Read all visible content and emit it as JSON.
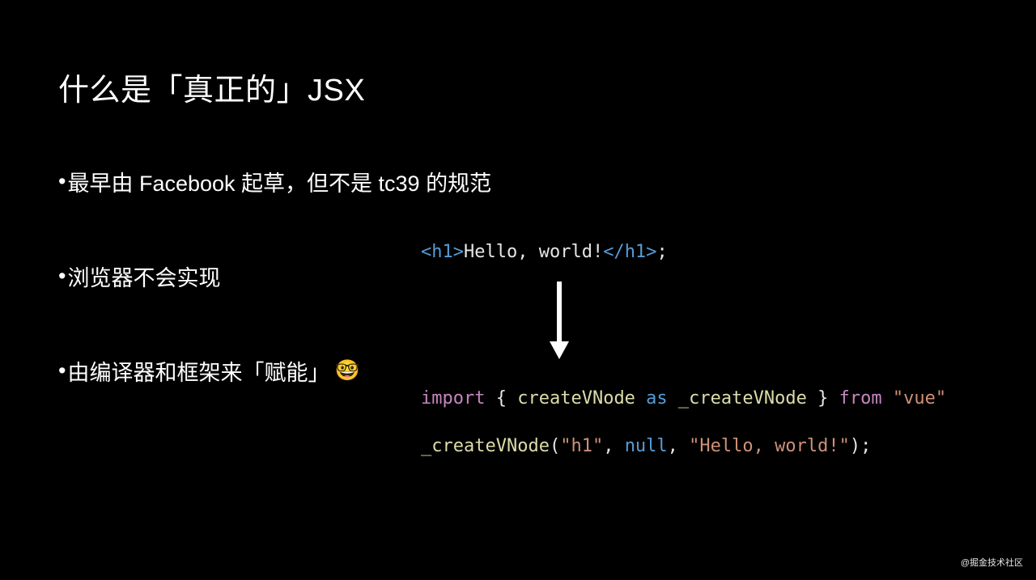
{
  "title": "什么是「真正的」JSX",
  "bullets": {
    "b1": "最早由 Facebook 起草，但不是 tc39 的规范",
    "b2": "浏览器不会实现",
    "b3": "由编译器和框架来「赋能」"
  },
  "emoji": "🤓",
  "code": {
    "line1": {
      "open_bracket": "<",
      "tag1": "h1",
      "close_bracket": ">",
      "text": "Hello, world!",
      "open_bracket2": "</",
      "tag2": "h1",
      "close_bracket2": ">",
      "semi": ";"
    },
    "line2": {
      "import": "import",
      "lbrace": " { ",
      "name1": "createVNode",
      "as": " as ",
      "name2": "_createVNode",
      "rbrace": " } ",
      "from": "from",
      "space": " ",
      "str": "\"vue\""
    },
    "line3": {
      "fn": "_createVNode",
      "lparen": "(",
      "arg1": "\"h1\"",
      "comma1": ", ",
      "arg2": "null",
      "comma2": ", ",
      "arg3": "\"Hello, world!\"",
      "rparen": ")",
      "semi": ";"
    }
  },
  "credit": "@掘金技术社区"
}
